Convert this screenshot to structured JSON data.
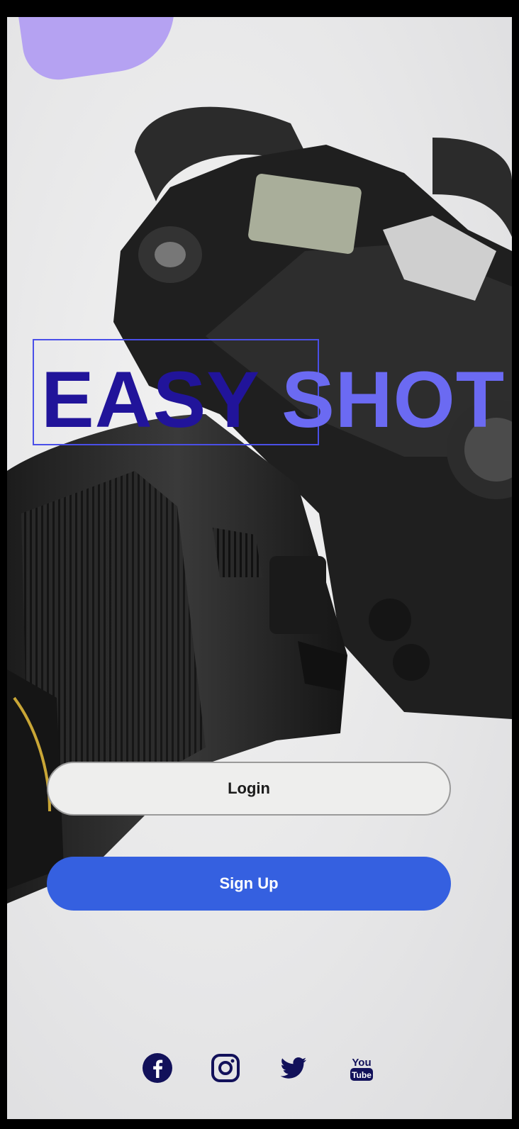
{
  "brand": {
    "part1": "EASY",
    "part2": "SHOT"
  },
  "buttons": {
    "login": "Login",
    "signup": "Sign Up"
  },
  "social": [
    {
      "icon": "facebook-icon"
    },
    {
      "icon": "instagram-icon"
    },
    {
      "icon": "twitter-icon"
    },
    {
      "icon": "youtube-icon",
      "label": "You Tube"
    }
  ],
  "colors": {
    "brand_dark": "#21149a",
    "brand_light": "#6b6af2",
    "primary": "#3560e0",
    "icon": "#12115a"
  }
}
